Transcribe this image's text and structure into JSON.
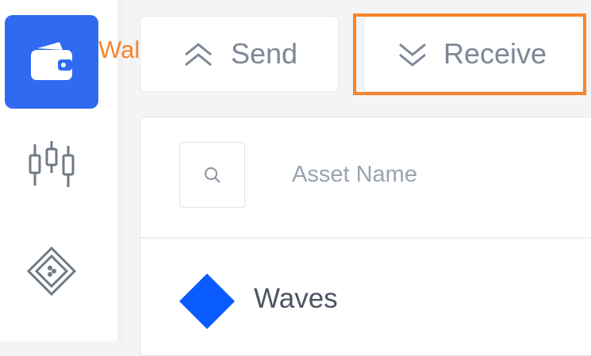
{
  "sidebar": {
    "items": [
      {
        "icon": "wallet-icon",
        "active": true
      },
      {
        "icon": "candlestick-chart-icon",
        "active": false
      },
      {
        "icon": "dex-diamond-icon",
        "active": false
      }
    ],
    "active_color": "#2f6af0"
  },
  "tooltip": {
    "label": "Wallet",
    "color": "#f5842c"
  },
  "toolbar": {
    "send_label": "Send",
    "receive_label": "Receive",
    "highlight_color": "#f5842c"
  },
  "assets_table": {
    "header_label": "Asset Name",
    "rows": [
      {
        "name": "Waves",
        "icon": "waves-diamond-icon",
        "color": "#0b5cff"
      }
    ]
  }
}
